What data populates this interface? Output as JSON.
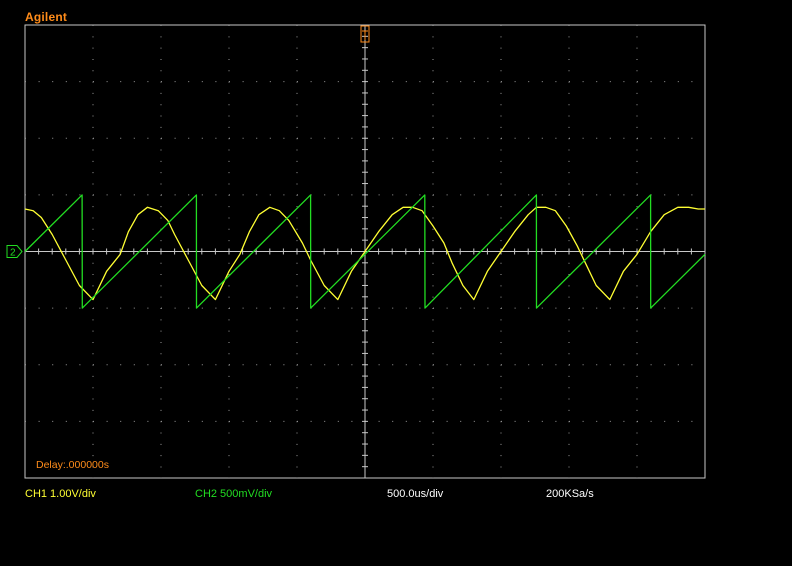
{
  "brand": "Agilent",
  "status": {
    "ch1": "CH1 1.00V/div",
    "ch2": "CH2 500mV/div",
    "timebase": "500.0us/div",
    "sample_rate": "200KSa/s"
  },
  "delay": "Delay:.000000s",
  "ch2_marker": "2",
  "colors": {
    "ch1": "#ffff33",
    "ch2": "#22dd22",
    "trigger": "#ff8c1a",
    "grid": "#9a9a9a",
    "frame": "#c8c8c8"
  },
  "chart_data": {
    "type": "line",
    "grid": true,
    "divisions": {
      "x": 10,
      "y": 8
    },
    "xlim": [
      -2500,
      2500
    ],
    "ylim": [
      -4,
      4
    ],
    "series": [
      {
        "name": "CH1",
        "description_values": "rectified-sine-like arches",
        "x": [
          -2500,
          -2440,
          -2380,
          -2300,
          -2200,
          -2100,
          -2000,
          -1900,
          -1800,
          -1740,
          -1670,
          -1600,
          -1520,
          -1450,
          -1400,
          -1300,
          -1200,
          -1100,
          -1000,
          -920,
          -850,
          -780,
          -700,
          -630,
          -560,
          -460,
          -400,
          -300,
          -200,
          -100,
          0,
          100,
          200,
          280,
          350,
          420,
          500,
          580,
          640,
          720,
          800,
          900,
          1000,
          1100,
          1200,
          1260,
          1330,
          1400,
          1480,
          1560,
          1620,
          1700,
          1800,
          1900,
          2000,
          2100,
          2200,
          2300,
          2380,
          2450,
          2500
        ],
        "y": [
          0.75,
          0.72,
          0.6,
          0.3,
          -0.15,
          -0.6,
          -0.85,
          -0.35,
          -0.05,
          0.35,
          0.65,
          0.78,
          0.72,
          0.55,
          0.3,
          -0.15,
          -0.6,
          -0.85,
          -0.35,
          -0.05,
          0.35,
          0.65,
          0.78,
          0.72,
          0.55,
          0.15,
          -0.15,
          -0.6,
          -0.85,
          -0.35,
          0.0,
          0.35,
          0.65,
          0.78,
          0.78,
          0.72,
          0.45,
          0.15,
          -0.2,
          -0.6,
          -0.85,
          -0.35,
          0.0,
          0.35,
          0.65,
          0.78,
          0.78,
          0.72,
          0.45,
          0.1,
          -0.2,
          -0.6,
          -0.85,
          -0.35,
          -0.05,
          0.35,
          0.65,
          0.78,
          0.78,
          0.75,
          0.75
        ]
      },
      {
        "name": "CH2",
        "description_values": "sawtooth ramp",
        "x": [
          -2500,
          -2080,
          -2079,
          -1240,
          -1239,
          -400,
          -399,
          440,
          441,
          1260,
          1261,
          2100,
          2101,
          2500
        ],
        "y": [
          0.0,
          1.0,
          -1.0,
          1.0,
          -1.0,
          1.0,
          -1.0,
          1.0,
          -1.0,
          1.0,
          -1.0,
          1.0,
          -1.0,
          -0.05
        ]
      }
    ]
  }
}
